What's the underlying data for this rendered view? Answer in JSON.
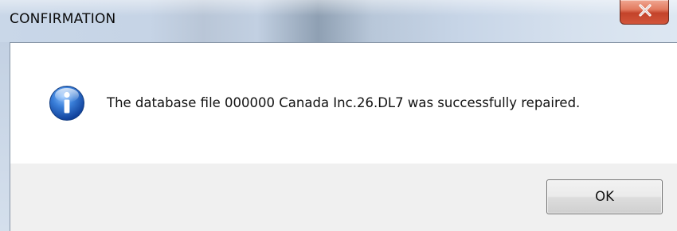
{
  "window": {
    "title": "CONFIRMATION",
    "close_icon": "close-x-icon"
  },
  "message": {
    "icon": "information-icon",
    "text": "The database file 000000 Canada Inc.26.DL7 was successfully repaired."
  },
  "buttons": {
    "ok_label": "OK"
  },
  "colors": {
    "close_button": "#c3432a",
    "info_icon": "#1f5fbf",
    "button_bar": "#f0f0f0"
  }
}
